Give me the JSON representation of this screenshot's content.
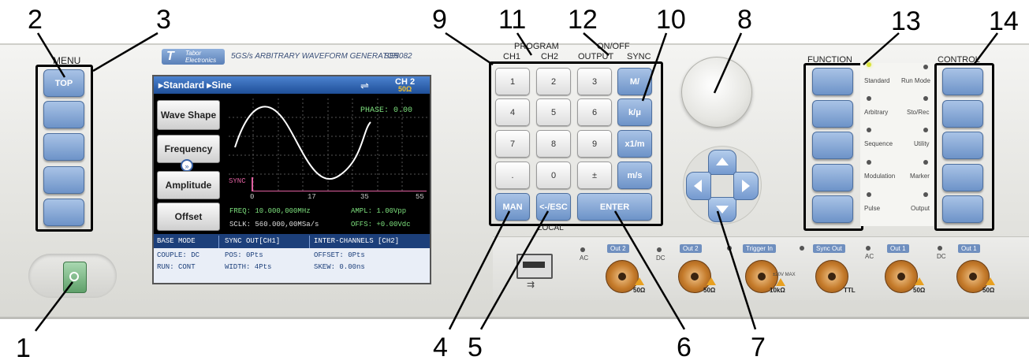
{
  "callouts": [
    "1",
    "2",
    "3",
    "4",
    "5",
    "6",
    "7",
    "8",
    "9",
    "10",
    "11",
    "12",
    "13",
    "14"
  ],
  "header": {
    "brand_line1": "Tabor",
    "brand_line2": "Electronics",
    "model_title": "5GS/s ARBITRARY WAVEFORM GENERATOR",
    "model_number": "SE5082"
  },
  "menu_label": "MENU",
  "top_button": "TOP",
  "screen": {
    "breadcrumb": "▸Standard ▸Sine",
    "channel": "CH 2",
    "impedance": "50Ω",
    "softkeys": [
      "Wave Shape",
      "Frequency",
      "Amplitude",
      "Offset"
    ],
    "phase": "PHASE: 0.00",
    "sync": "SYNC",
    "x_ticks": [
      "0",
      "17",
      "35",
      "55"
    ],
    "freq": "FREQ: 10.000,000MHz",
    "ampl": "AMPL: 1.00Vpp",
    "sclk": "SCLK: 560.000,00MSa/s",
    "offs": "OFFS: +0.00Vdc",
    "bottom": {
      "base_mode": "BASE MODE",
      "couple": "COUPLE: DC",
      "run": "RUN: CONT",
      "sync_out": "SYNC OUT[CH1]",
      "pos": "POS: 0Pts",
      "width": "WIDTH: 4Pts",
      "inter": "INTER-CHANNELS [CH2]",
      "offset": "OFFSET: 0Pts",
      "skew": "SKEW: 0.00ns"
    }
  },
  "keypad": {
    "program": "PROGRAM",
    "onoff": "ON/OFF",
    "ch1": "CH1",
    "ch2": "CH2",
    "output": "OUTPUT",
    "sync": "SYNC",
    "digits": [
      "1",
      "2",
      "3",
      "4",
      "5",
      "6",
      "7",
      "8",
      "9",
      ".",
      "0",
      "±"
    ],
    "units": [
      "M/",
      "k/μ",
      "x1/m",
      "m/s"
    ],
    "man": "MAN",
    "esc": "<-/ESC",
    "enter": "ENTER",
    "local": "LOCAL"
  },
  "function_label": "FUNCTION",
  "control_label": "CONTROL",
  "function_leds": [
    "Standard",
    "Arbitrary",
    "Sequence",
    "Modulation",
    "Pulse"
  ],
  "control_leds": [
    "Run Mode",
    "Sto/Rec",
    "Utility",
    "Marker",
    "Output"
  ],
  "connectors": {
    "ac1": "AC",
    "out2_a": "Out 2",
    "dc1": "DC",
    "out2_b": "Out 2",
    "trigger": "Trigger In",
    "trigger_max": "±20V MAX",
    "syncout": "Sync Out",
    "ac2": "AC",
    "out1_a": "Out 1",
    "dc2": "DC",
    "out1_b": "Out 1",
    "ohm50": "50Ω",
    "k10": "10kΩ",
    "ttl": "TTL"
  },
  "colors": {
    "blue_button": "#7a9fd3",
    "screen_header": "#2a5fa8",
    "waveform": "#ffffff",
    "led_on": "#d8e23a"
  }
}
